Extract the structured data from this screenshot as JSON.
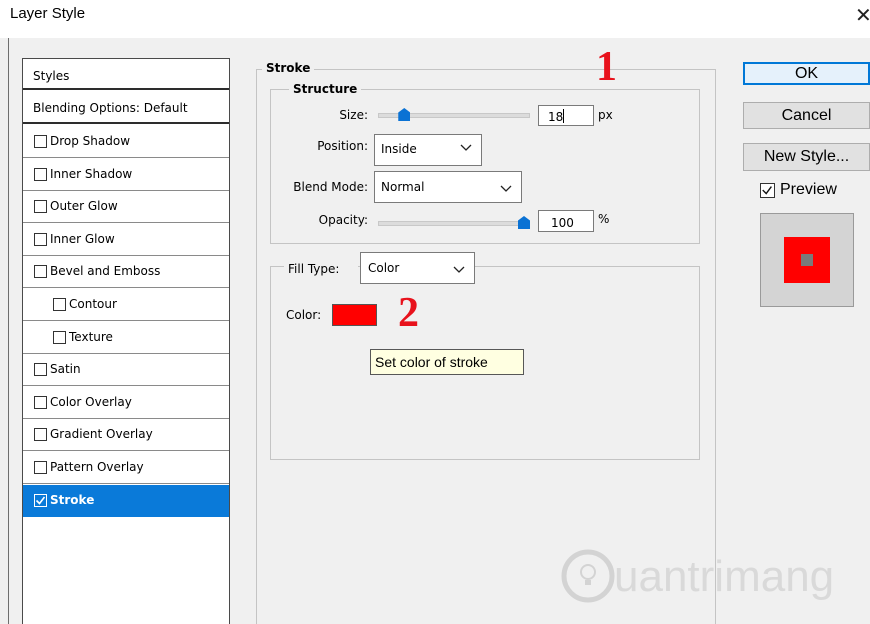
{
  "window": {
    "title": "Layer Style",
    "close_glyph": "✕"
  },
  "styles_panel": {
    "header": "Styles",
    "blending_options": "Blending Options: Default",
    "items": [
      {
        "label": "Drop Shadow",
        "checked": false,
        "sub": false
      },
      {
        "label": "Inner Shadow",
        "checked": false,
        "sub": false
      },
      {
        "label": "Outer Glow",
        "checked": false,
        "sub": false
      },
      {
        "label": "Inner Glow",
        "checked": false,
        "sub": false
      },
      {
        "label": "Bevel and Emboss",
        "checked": false,
        "sub": false
      },
      {
        "label": "Contour",
        "checked": false,
        "sub": true
      },
      {
        "label": "Texture",
        "checked": false,
        "sub": true
      },
      {
        "label": "Satin",
        "checked": false,
        "sub": false
      },
      {
        "label": "Color Overlay",
        "checked": false,
        "sub": false
      },
      {
        "label": "Gradient Overlay",
        "checked": false,
        "sub": false
      },
      {
        "label": "Pattern Overlay",
        "checked": false,
        "sub": false
      },
      {
        "label": "Stroke",
        "checked": true,
        "sub": false,
        "selected": true
      }
    ]
  },
  "stroke": {
    "section_title": "Stroke",
    "structure_title": "Structure",
    "size_label": "Size:",
    "size_value": "18",
    "size_unit": "px",
    "size_slider_level": 0.06,
    "position_label": "Position:",
    "position_value": "Inside",
    "blend_mode_label": "Blend Mode:",
    "blend_mode_value": "Normal",
    "opacity_label": "Opacity:",
    "opacity_value": "100",
    "opacity_unit": "%",
    "opacity_slider_level": 1.0,
    "fill_type_label": "Fill Type:",
    "fill_type_value": "Color",
    "color_label": "Color:",
    "stroke_color": "#ff0000",
    "tooltip": "Set color of stroke"
  },
  "annotations": {
    "marker_1": "1",
    "marker_2": "2",
    "marker_color": "#e8121c"
  },
  "buttons": {
    "ok": "OK",
    "cancel": "Cancel",
    "new_style": "New Style..."
  },
  "preview": {
    "label": "Preview",
    "checked": true,
    "swatch_fill": "#ff0000",
    "swatch_center": "#7a7a7a"
  },
  "watermark": {
    "text": "uantrimang",
    "icon": "lightbulb-icon"
  },
  "icons": {
    "checkbox_checked": "checkmark-icon",
    "dropdown": "chevron-down-icon",
    "slider": "slider-thumb-icon"
  }
}
